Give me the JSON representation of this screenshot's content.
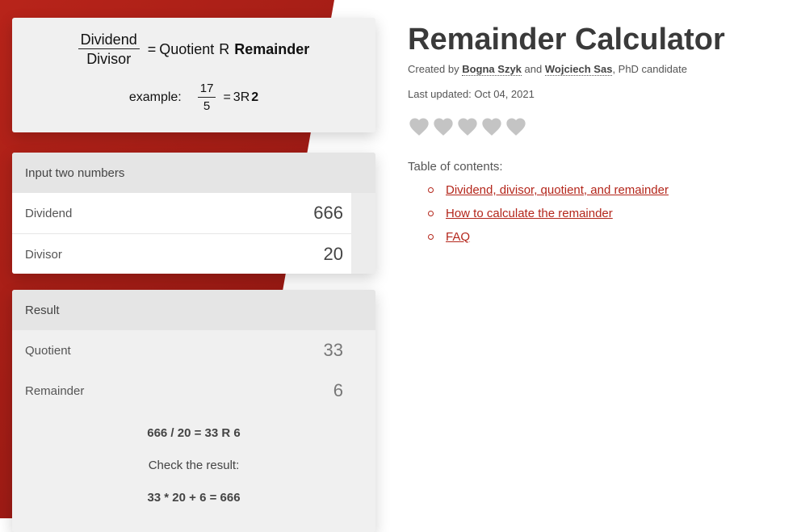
{
  "formula": {
    "dividend": "Dividend",
    "divisor": "Divisor",
    "equals": "=",
    "quotient": "Quotient",
    "r": "R",
    "remainder": "Remainder",
    "example_label": "example:",
    "example_num": "17",
    "example_den": "5",
    "example_quotient": "3",
    "example_r": "R",
    "example_remainder": "2"
  },
  "inputs": {
    "header": "Input two numbers",
    "dividend_label": "Dividend",
    "dividend_value": "666",
    "divisor_label": "Divisor",
    "divisor_value": "20"
  },
  "result": {
    "header": "Result",
    "quotient_label": "Quotient",
    "quotient_value": "33",
    "remainder_label": "Remainder",
    "remainder_value": "6",
    "summary": "666 / 20 = 33 R 6",
    "check_label": "Check the result:",
    "check_expr": "33 * 20 + 6 = 666"
  },
  "page": {
    "title": "Remainder Calculator",
    "created_by": "Created by",
    "author1": "Bogna Szyk",
    "and": "and",
    "author2": "Wojciech Sas",
    "author2_suffix": ", PhD candidate",
    "last_updated": "Last updated: Oct 04, 2021",
    "rating_hearts": 5,
    "heart_color": "#c4c4c4",
    "toc_title": "Table of contents:",
    "toc": [
      "Dividend, divisor, quotient, and remainder",
      "How to calculate the remainder",
      "FAQ"
    ],
    "accent_color": "#b4261b"
  }
}
